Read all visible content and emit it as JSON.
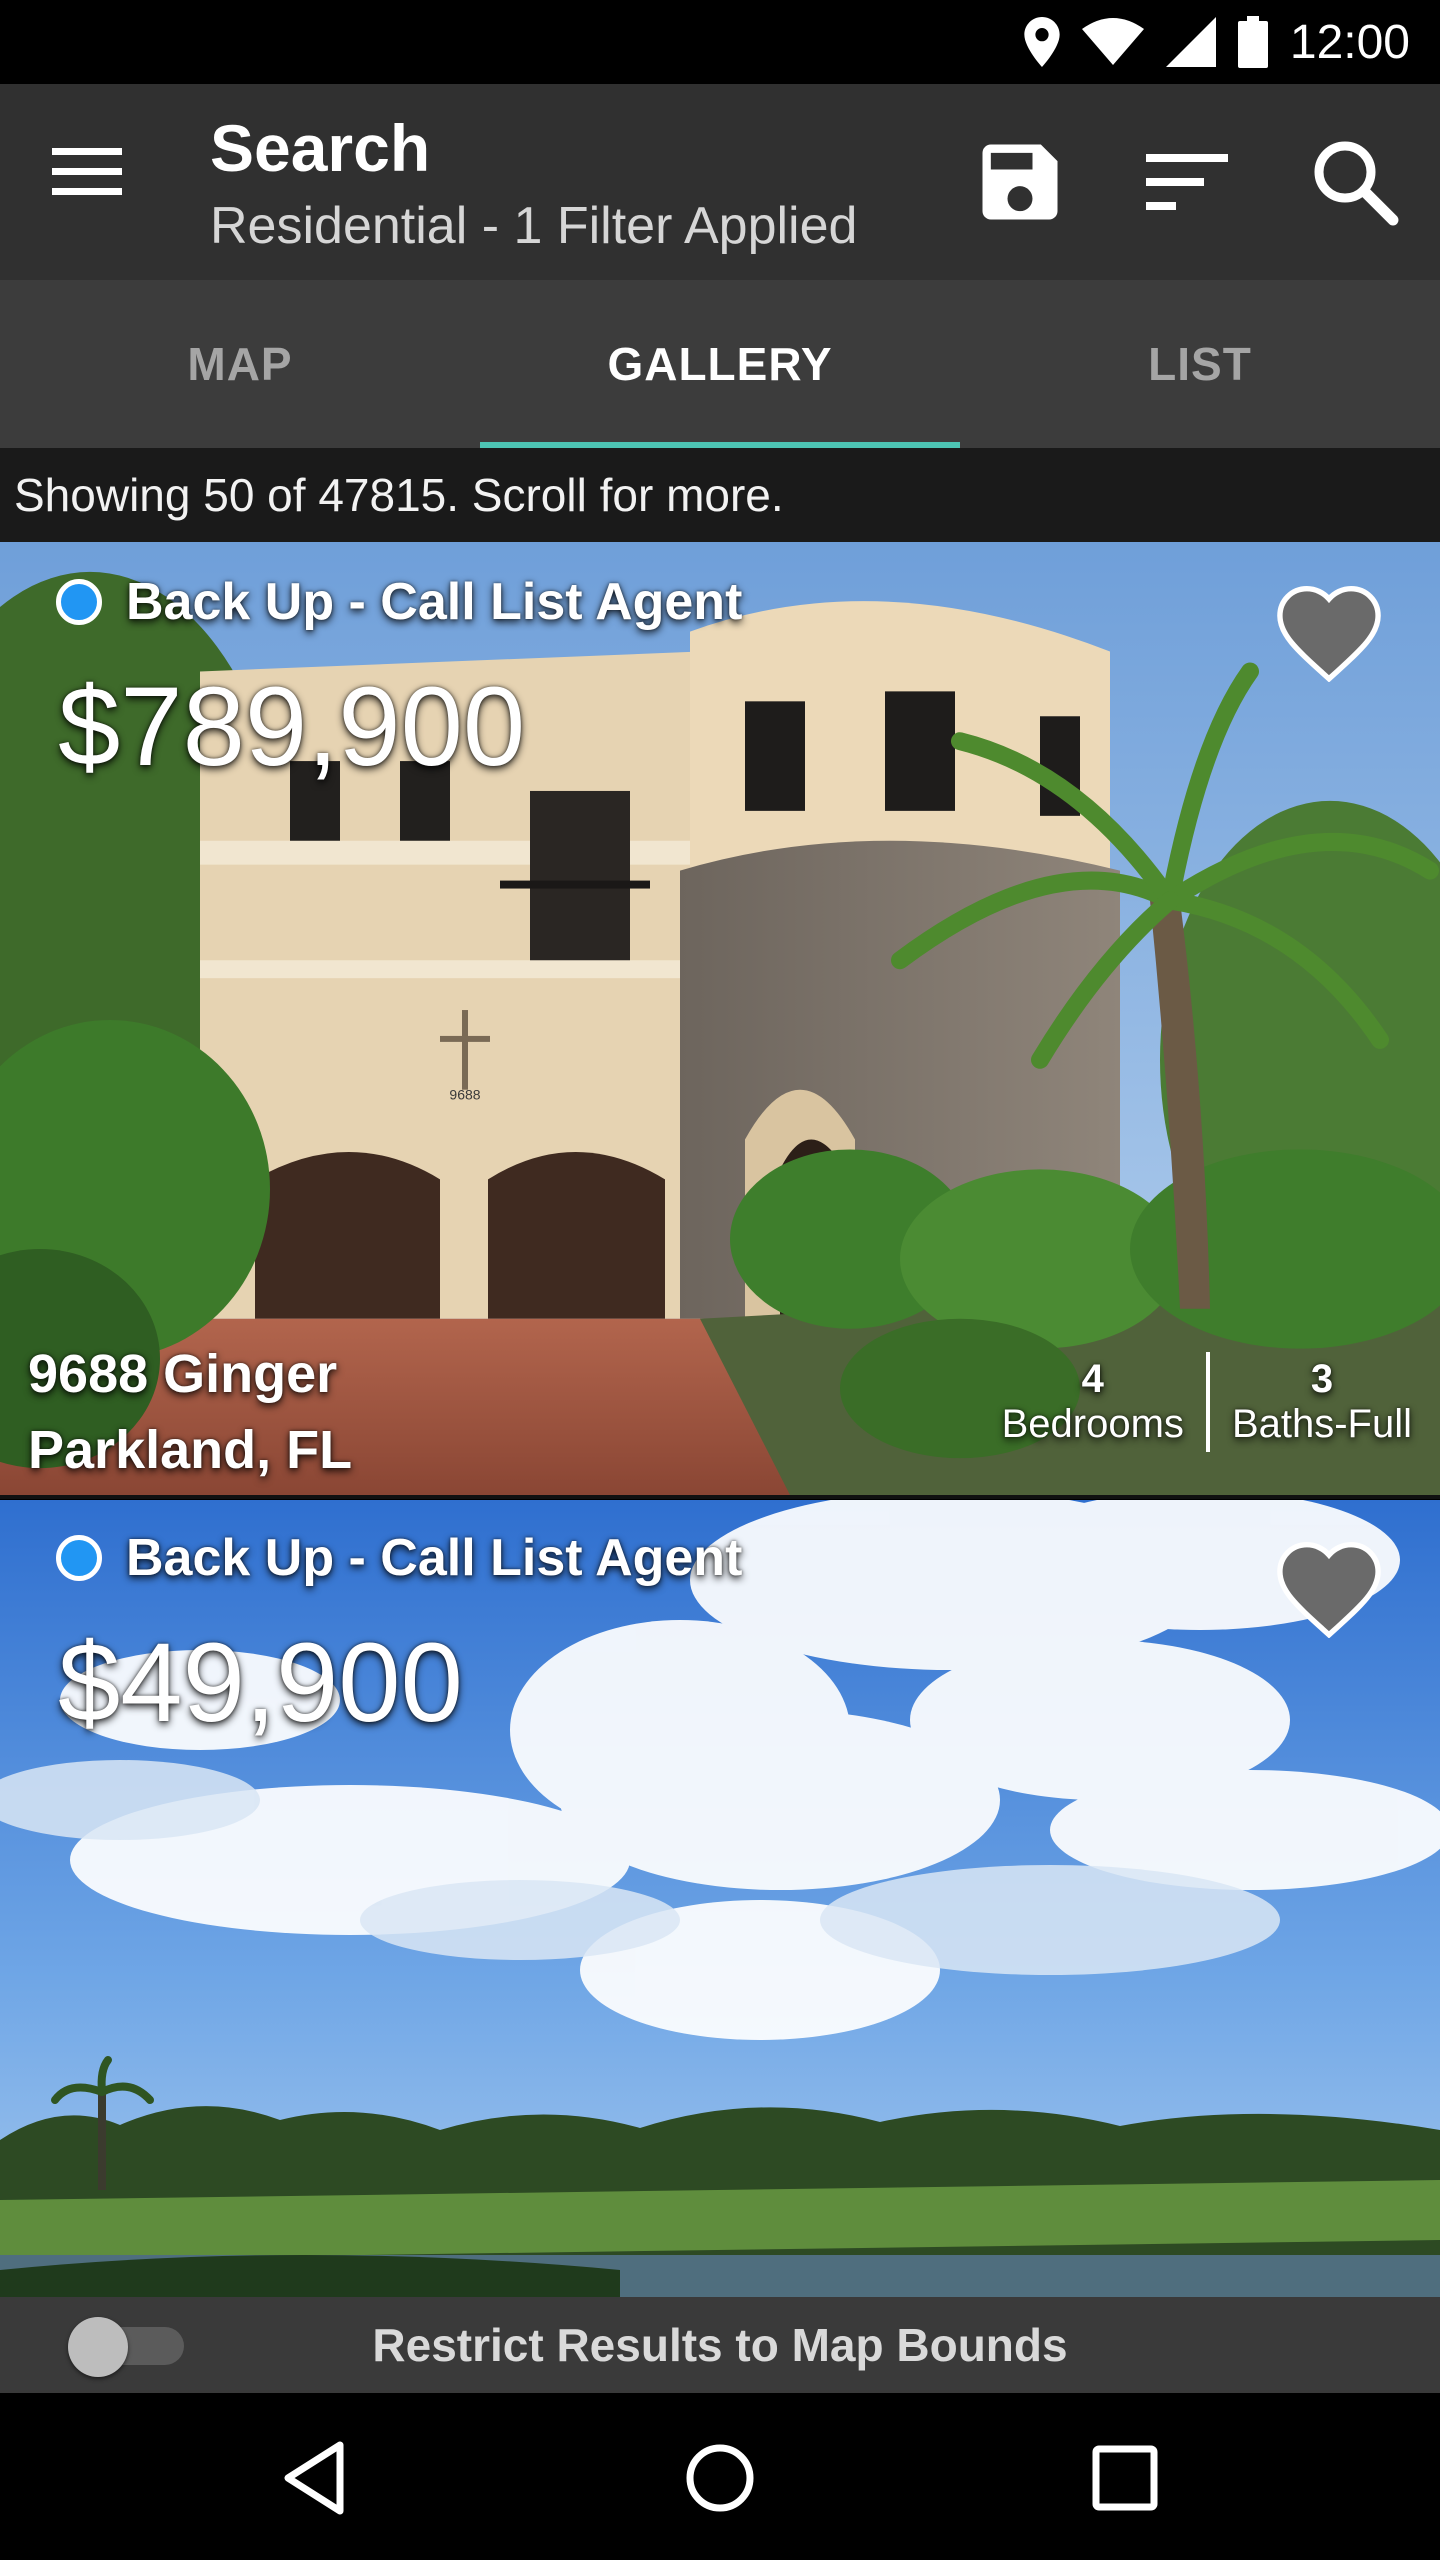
{
  "status_bar": {
    "time": "12:00",
    "icons": [
      "location-icon",
      "wifi-icon",
      "signal-icon",
      "battery-icon"
    ]
  },
  "app_bar": {
    "title": "Search",
    "subtitle": "Residential - 1 Filter Applied",
    "icons": [
      "menu-icon",
      "save-icon",
      "sort-icon",
      "search-icon"
    ]
  },
  "tabs": [
    {
      "label": "MAP",
      "active": false
    },
    {
      "label": "GALLERY",
      "active": true
    },
    {
      "label": "LIST",
      "active": false
    }
  ],
  "results": {
    "summary": "Showing 50 of 47815. Scroll for more."
  },
  "listings": [
    {
      "status": "Back Up - Call List Agent",
      "price": "$789,900",
      "address_line1": "9688 Ginger",
      "address_line2": "Parkland, FL",
      "bedrooms": "4",
      "bedrooms_label": "Bedrooms",
      "baths": "3",
      "baths_label": "Baths-Full",
      "house_number_sign": "9688"
    },
    {
      "status": "Back Up - Call List Agent",
      "price": "$49,900"
    }
  ],
  "bottom_bar": {
    "restrict_label": "Restrict Results to Map Bounds",
    "toggle_on": false
  },
  "nav_bar": {
    "icons": [
      "back-icon",
      "home-icon",
      "recents-icon"
    ]
  },
  "colors": {
    "accent": "#4dc4b3",
    "status_dot": "#2196f3",
    "app_bar": "#303030",
    "tab_bar": "#3c3c3c"
  }
}
